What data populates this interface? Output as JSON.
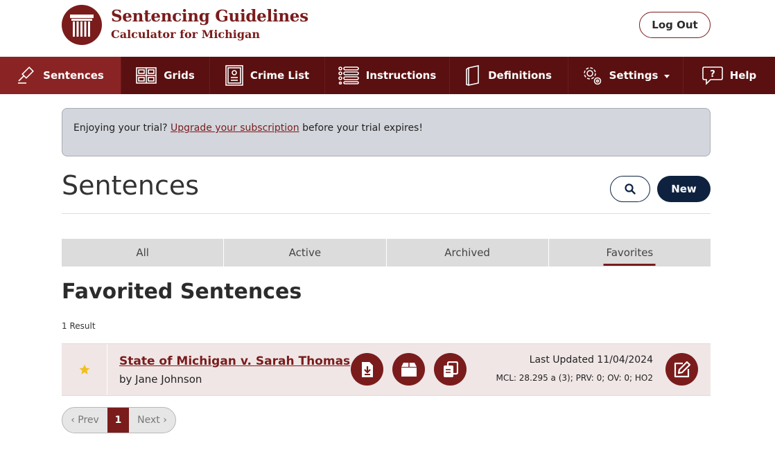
{
  "brand": {
    "title": "Sentencing Guidelines",
    "subtitle": "Calculator for Michigan"
  },
  "header": {
    "logout_label": "Log Out"
  },
  "nav": {
    "items": [
      {
        "label": "Sentences",
        "icon": "gavel-icon"
      },
      {
        "label": "Grids",
        "icon": "grid-icon"
      },
      {
        "label": "Crime List",
        "icon": "document-list-icon"
      },
      {
        "label": "Instructions",
        "icon": "list-icon"
      },
      {
        "label": "Definitions",
        "icon": "book-icon"
      },
      {
        "label": "Settings",
        "icon": "gear-icon"
      },
      {
        "label": "Help",
        "icon": "help-icon"
      }
    ]
  },
  "banner": {
    "prefix": "Enjoying your trial? ",
    "link": "Upgrade your subscription",
    "suffix": " before your trial expires!"
  },
  "page": {
    "title": "Sentences",
    "new_label": "New"
  },
  "tabs": [
    {
      "label": "All"
    },
    {
      "label": "Active"
    },
    {
      "label": "Archived"
    },
    {
      "label": "Favorites",
      "selected": true
    }
  ],
  "section": {
    "title": "Favorited Sentences",
    "count": "1 Result"
  },
  "rows": [
    {
      "title": "State of Michigan v. Sarah Thomas",
      "author": "by Jane Johnson",
      "updated": "Last Updated 11/04/2024",
      "details": "MCL: 28.295 a (3); PRV: 0; OV: 0; HO2"
    }
  ],
  "pagination": {
    "prev": "‹ Prev",
    "current": "1",
    "next": "Next ›"
  },
  "colors": {
    "brand": "#7a1c1c",
    "nav": "#5a1010",
    "nav_active": "#8a2424",
    "primary_button": "#0e2240",
    "star": "#f0c020"
  }
}
